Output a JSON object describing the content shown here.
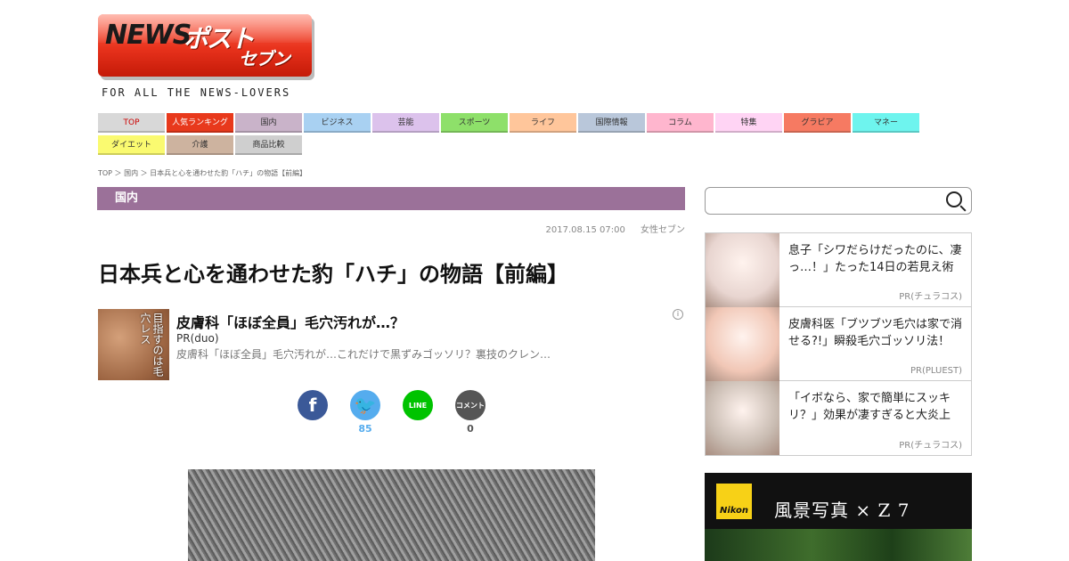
{
  "logo": {
    "news": "NEWS",
    "post": "ポスト",
    "seven": "セブン",
    "tagline": "FOR ALL THE NEWS-LOVERS"
  },
  "nav": [
    {
      "label": "TOP",
      "color": "#d8d8d8",
      "text": "#c00"
    },
    {
      "label": "人気ランキング",
      "color": "#e8391c",
      "text": "#fff"
    },
    {
      "label": "国内",
      "color": "#c9b3c9",
      "text": "#333"
    },
    {
      "label": "ビジネス",
      "color": "#a9d1f2",
      "text": "#333"
    },
    {
      "label": "芸能",
      "color": "#dcc2ec",
      "text": "#333"
    },
    {
      "label": "スポーツ",
      "color": "#8ee06a",
      "text": "#333"
    },
    {
      "label": "ライフ",
      "color": "#ffc69b",
      "text": "#333"
    },
    {
      "label": "国際情報",
      "color": "#b9c7da",
      "text": "#333"
    },
    {
      "label": "コラム",
      "color": "#ffb6ce",
      "text": "#333"
    },
    {
      "label": "特集",
      "color": "#ffd4f4",
      "text": "#333"
    },
    {
      "label": "グラビア",
      "color": "#f67a62",
      "text": "#333"
    },
    {
      "label": "マネー",
      "color": "#6ef4ee",
      "text": "#333"
    },
    {
      "label": "ダイエット",
      "color": "#fafa70",
      "text": "#333"
    },
    {
      "label": "介護",
      "color": "#cdb39f",
      "text": "#333"
    },
    {
      "label": "商品比較",
      "color": "#cfcfcf",
      "text": "#333"
    }
  ],
  "breadcrumb": "TOP ＞ 国内 ＞ 日本兵と心を通わせた豹「ハチ」の物語【前編】",
  "category": "国内",
  "meta": {
    "date": "2017.08.15 07:00",
    "source": "女性セブン"
  },
  "headline": "日本兵と心を通わせた豹「ハチ」の物語【前編】",
  "pr": {
    "thumb_text": "目指すのは毛穴レス",
    "title": "皮膚科「ほぼ全員」毛穴汚れが…？",
    "source": "PR(duo)",
    "desc": "皮膚科「ほぼ全員」毛穴汚れが…これだけで黒ずみゴッソリ？裏技のクレン…"
  },
  "social": [
    {
      "name": "facebook",
      "glyph": "f",
      "color": "#3b5998",
      "count": ""
    },
    {
      "name": "twitter",
      "glyph": "🐦",
      "color": "#55acee",
      "count": "85"
    },
    {
      "name": "line",
      "glyph": "LINE",
      "color": "#00c300",
      "count": ""
    },
    {
      "name": "comment",
      "glyph": "コメント",
      "color": "#555",
      "count": "0"
    }
  ],
  "search": {
    "placeholder": ""
  },
  "ads": [
    {
      "text": "息子「シワだらけだったのに、凄っ…！」たった14日の若見え術",
      "source": "PR(チュラコス)",
      "thumb": "#e8d5d0"
    },
    {
      "text": "皮膚科医「ブツブツ毛穴は家で消せる?!」瞬殺毛穴ゴッソリ法！",
      "source": "PR(PLUEST)",
      "thumb": "#f1c7b6"
    },
    {
      "text": "「イボなら、家で簡単にスッキリ？」効果が凄すぎると大炎上",
      "source": "PR(チュラコス)",
      "thumb": "#c9bcb2"
    }
  ],
  "nikon": {
    "logo": "Nikon",
    "text": "風景写真 × Z 7"
  }
}
